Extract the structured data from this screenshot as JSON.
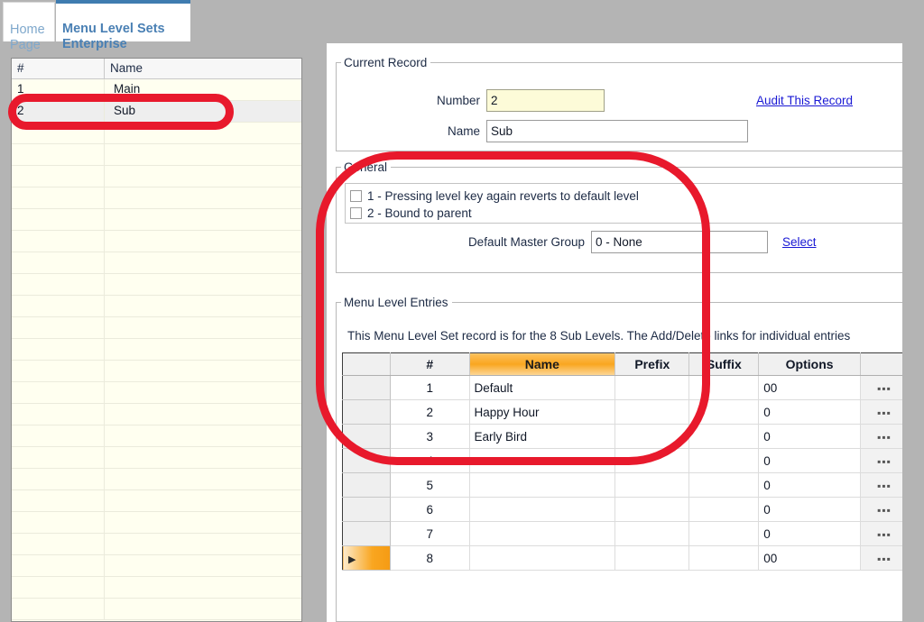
{
  "window": {
    "background_color": "#b4b4b4"
  },
  "tabs": [
    {
      "label": "Home\nPage",
      "active": false,
      "name": "tab-home-page"
    },
    {
      "label": "Menu Level Sets\nEnterprise",
      "active": true,
      "name": "tab-menu-level-sets-enterprise"
    }
  ],
  "record_list": {
    "columns": [
      "#",
      "Name"
    ],
    "rows": [
      {
        "num": "1",
        "name": "Main",
        "selected": false
      },
      {
        "num": "2",
        "name": "Sub",
        "selected": true
      },
      {
        "num": "",
        "name": "",
        "selected": false
      },
      {
        "num": "",
        "name": "",
        "selected": false
      },
      {
        "num": "",
        "name": "",
        "selected": false
      },
      {
        "num": "",
        "name": "",
        "selected": false
      },
      {
        "num": "",
        "name": "",
        "selected": false
      },
      {
        "num": "",
        "name": "",
        "selected": false
      },
      {
        "num": "",
        "name": "",
        "selected": false
      },
      {
        "num": "",
        "name": "",
        "selected": false
      },
      {
        "num": "",
        "name": "",
        "selected": false
      },
      {
        "num": "",
        "name": "",
        "selected": false
      },
      {
        "num": "",
        "name": "",
        "selected": false
      },
      {
        "num": "",
        "name": "",
        "selected": false
      },
      {
        "num": "",
        "name": "",
        "selected": false
      },
      {
        "num": "",
        "name": "",
        "selected": false
      },
      {
        "num": "",
        "name": "",
        "selected": false
      },
      {
        "num": "",
        "name": "",
        "selected": false
      },
      {
        "num": "",
        "name": "",
        "selected": false
      },
      {
        "num": "",
        "name": "",
        "selected": false
      },
      {
        "num": "",
        "name": "",
        "selected": false
      },
      {
        "num": "",
        "name": "",
        "selected": false
      },
      {
        "num": "",
        "name": "",
        "selected": false
      },
      {
        "num": "",
        "name": "",
        "selected": false
      },
      {
        "num": "",
        "name": "",
        "selected": false
      }
    ]
  },
  "current_record": {
    "legend": "Current Record",
    "number_label": "Number",
    "number_value": "2",
    "name_label": "Name",
    "name_value": "Sub",
    "audit_link": "Audit This Record"
  },
  "general": {
    "legend": "General",
    "checkboxes": [
      {
        "label": "1 - Pressing level key again reverts to default level",
        "checked": false
      },
      {
        "label": "2 - Bound to parent",
        "checked": false
      }
    ],
    "master_group_label": "Default Master Group",
    "master_group_value": "0 - None",
    "select_link": "Select"
  },
  "menu_level_entries": {
    "legend": "Menu Level Entries",
    "note": "This Menu Level Set record is for the 8 Sub Levels. The Add/Delete links for individual entries",
    "columns": [
      "",
      "#",
      "Name",
      "Prefix",
      "Suffix",
      "Options",
      ""
    ],
    "rows": [
      {
        "marker": "",
        "num": "1",
        "name": "Default",
        "prefix": "",
        "suffix": "",
        "options": "00",
        "dots": "▪▪▪",
        "current": false
      },
      {
        "marker": "",
        "num": "2",
        "name": "Happy Hour",
        "prefix": "",
        "suffix": "",
        "options": "0",
        "dots": "▪▪▪",
        "current": false
      },
      {
        "marker": "",
        "num": "3",
        "name": "Early Bird",
        "prefix": "",
        "suffix": "",
        "options": "0",
        "dots": "▪▪▪",
        "current": false
      },
      {
        "marker": "",
        "num": "4",
        "name": "",
        "prefix": "",
        "suffix": "",
        "options": "0",
        "dots": "▪▪▪",
        "current": false
      },
      {
        "marker": "",
        "num": "5",
        "name": "",
        "prefix": "",
        "suffix": "",
        "options": "0",
        "dots": "▪▪▪",
        "current": false
      },
      {
        "marker": "",
        "num": "6",
        "name": "",
        "prefix": "",
        "suffix": "",
        "options": "0",
        "dots": "▪▪▪",
        "current": false
      },
      {
        "marker": "",
        "num": "7",
        "name": "",
        "prefix": "",
        "suffix": "",
        "options": "0",
        "dots": "▪▪▪",
        "current": false
      },
      {
        "marker": "▶",
        "num": "8",
        "name": "",
        "prefix": "",
        "suffix": "",
        "options": "00",
        "dots": "▪▪▪",
        "current": true
      }
    ]
  },
  "annotations": {
    "color": "#e8192c",
    "shapes": [
      {
        "name": "annotation-ellipse-selected-row",
        "target": "record-list row 2 Sub"
      },
      {
        "name": "annotation-ellipse-general-and-entries",
        "target": "General group + Menu Level Entries top rows"
      }
    ]
  },
  "colors": {
    "accent_orange": "#f9a620",
    "link_blue": "#1a19d4",
    "tab_active_text": "#4a80b4",
    "tab_inactive_text": "#7fa8cc",
    "grid_cream": "#fffff0",
    "annotation_red": "#e8192c"
  }
}
